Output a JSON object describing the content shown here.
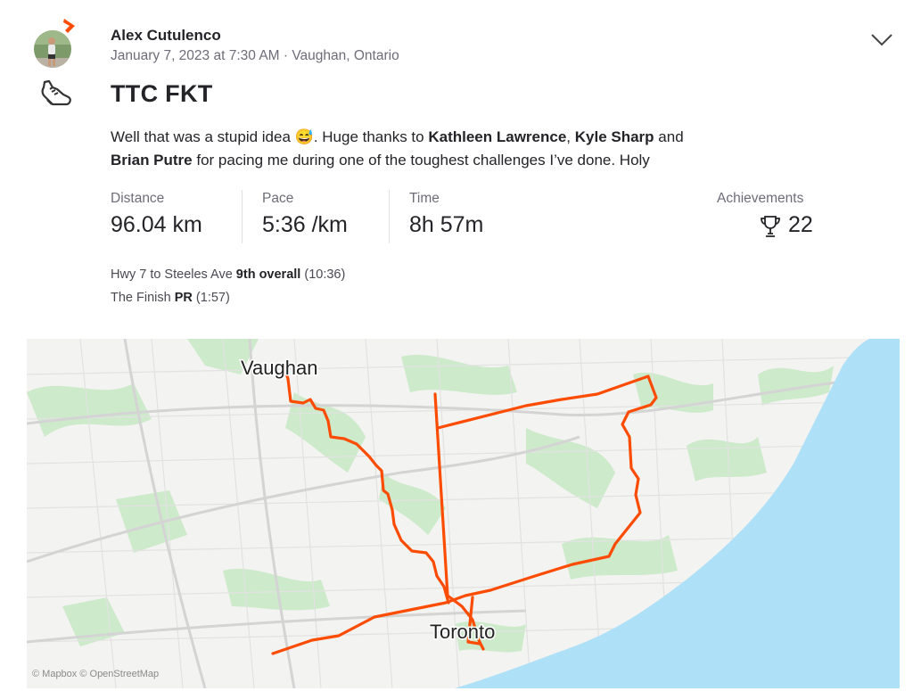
{
  "activity": {
    "athlete_name": "Alex Cutulenco",
    "datetime_location": "January 7, 2023 at 7:30 AM · Vaughan, Ontario",
    "sport_icon": "running-shoe-icon",
    "title": "TTC FKT",
    "description": {
      "part1": "Well that was a stupid idea ",
      "emoji": "😅",
      "part2": ". Huge thanks to ",
      "name1": "Kathleen Lawrence",
      "sep1": ", ",
      "name2": "Kyle Sharp",
      "part3": " and",
      "name3": "Brian Putre",
      "part4": " for pacing me during one of the toughest challenges I’ve done. Holy"
    }
  },
  "stats": {
    "distance": {
      "label": "Distance",
      "value": "96.04 km"
    },
    "pace": {
      "label": "Pace",
      "value": "5:36 /km"
    },
    "time": {
      "label": "Time",
      "value": "8h 57m"
    },
    "achievements": {
      "label": "Achievements",
      "value": "22",
      "icon": "trophy-icon"
    }
  },
  "segments": [
    {
      "name": "Hwy 7 to Steeles Ave",
      "result": "9th overall",
      "time": "(10:36)"
    },
    {
      "name": "The Finish",
      "result": "PR",
      "time": "(1:57)"
    }
  ],
  "map": {
    "labels": {
      "north": "Vaughan",
      "south": "Toronto"
    },
    "attribution": "© Mapbox © OpenStreetMap",
    "route_color": "#fc4c02",
    "water_color": "#aee0f7",
    "park_color": "#cdeacb"
  },
  "menu_icon": "chevron-down-icon"
}
